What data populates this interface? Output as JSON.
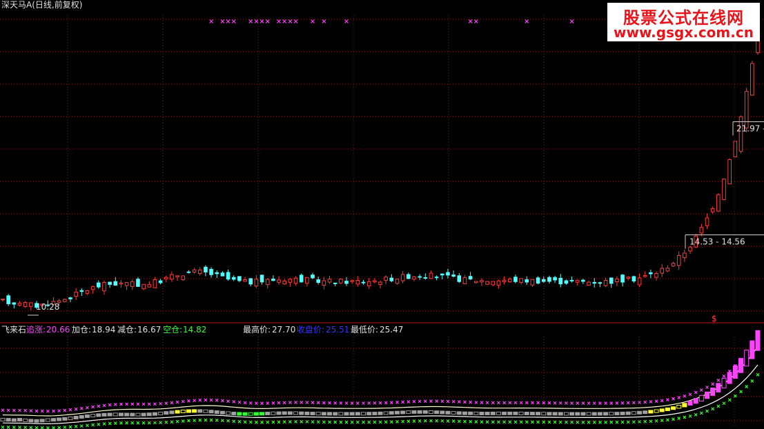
{
  "header": {
    "title": "深天马A(日线,前复权)"
  },
  "watermark": {
    "line1": "股票公式在线网",
    "line2": "www.gsgx.com.cn"
  },
  "main_panel": {
    "price_labels": [
      {
        "text": "21.97 -",
        "price": 21.97
      },
      {
        "text": "14.53 - 14.56",
        "price": 14.55
      },
      {
        "text": "10.28",
        "price": 10.28
      }
    ],
    "buy_marker": "$"
  },
  "indicator_panel": {
    "name": "飞来石",
    "legend": [
      {
        "label": "追涨",
        "value": "20.66",
        "label_color": "#ff44ff",
        "value_color": "#ff44ff"
      },
      {
        "label": "加仓",
        "value": "18.94",
        "label_color": "#e0e0e0",
        "value_color": "#e0e0e0"
      },
      {
        "label": "减仓",
        "value": "16.67",
        "label_color": "#e0e0e0",
        "value_color": "#e0e0e0"
      },
      {
        "label": "空仓",
        "value": "14.82",
        "label_color": "#33ff33",
        "value_color": "#33ff33"
      },
      {
        "label": "最高价",
        "value": "27.70",
        "label_color": "#e0e0e0",
        "value_color": "#e0e0e0"
      },
      {
        "label": "收盘价",
        "value": "25.51",
        "label_color": "#3333ff",
        "value_color": "#3333ff"
      },
      {
        "label": "最低价",
        "value": "25.47",
        "label_color": "#e0e0e0",
        "value_color": "#e0e0e0"
      }
    ]
  },
  "colors": {
    "up": "#ff3b3b",
    "down": "#54ffff",
    "grid": "#8b1a1a",
    "magenta": "#ff44ff",
    "yellow": "#ffff33",
    "green": "#33ff33",
    "gray": "#a0a0a0",
    "white": "#ffffff"
  },
  "chart_data": {
    "type": "candlestick",
    "ylim": [
      9.6,
      29.5
    ],
    "series": [
      {
        "name": "close",
        "values": [
          10.55,
          10.52,
          10.46,
          10.54,
          10.4,
          10.33,
          10.27,
          10.34,
          10.45,
          10.52,
          10.61,
          10.72,
          10.86,
          11.01,
          11.17,
          11.32,
          11.45,
          11.56,
          11.64,
          11.69,
          11.71,
          11.71,
          11.69,
          11.68,
          11.67,
          11.69,
          11.74,
          11.82,
          11.93,
          12.05,
          12.18,
          12.3,
          12.39,
          12.46,
          12.49,
          12.48,
          12.43,
          12.35,
          12.24,
          12.12,
          12.01,
          11.92,
          11.85,
          11.82,
          11.82,
          11.84,
          11.88,
          11.93,
          11.97,
          12.0,
          12.02,
          12.02,
          12.01,
          11.98,
          11.95,
          11.92,
          11.9,
          11.88,
          11.87,
          11.86,
          11.86,
          11.86,
          11.86,
          11.87,
          11.88,
          11.9,
          11.92,
          11.96,
          12.01,
          12.06,
          12.12,
          12.17,
          12.22,
          12.25,
          12.26,
          12.26,
          12.24,
          12.21,
          12.17,
          12.12,
          12.07,
          12.02,
          11.98,
          11.96,
          11.94,
          11.93,
          11.93,
          11.94,
          11.94,
          11.95,
          11.95,
          11.95,
          11.94,
          11.93,
          11.92,
          11.91,
          11.89,
          11.88,
          11.87,
          11.86,
          11.85,
          11.85,
          11.85,
          11.85,
          11.85,
          11.85,
          11.86,
          11.87,
          11.89,
          11.91,
          11.94,
          11.98,
          12.04,
          12.11,
          12.2,
          12.32,
          12.46,
          12.64,
          12.86,
          13.12,
          13.43,
          13.8,
          14.23,
          14.74,
          15.33,
          16.01,
          16.79,
          17.69,
          18.71,
          19.87,
          21.18,
          22.65,
          24.31,
          26.17,
          28.24
        ]
      }
    ]
  }
}
